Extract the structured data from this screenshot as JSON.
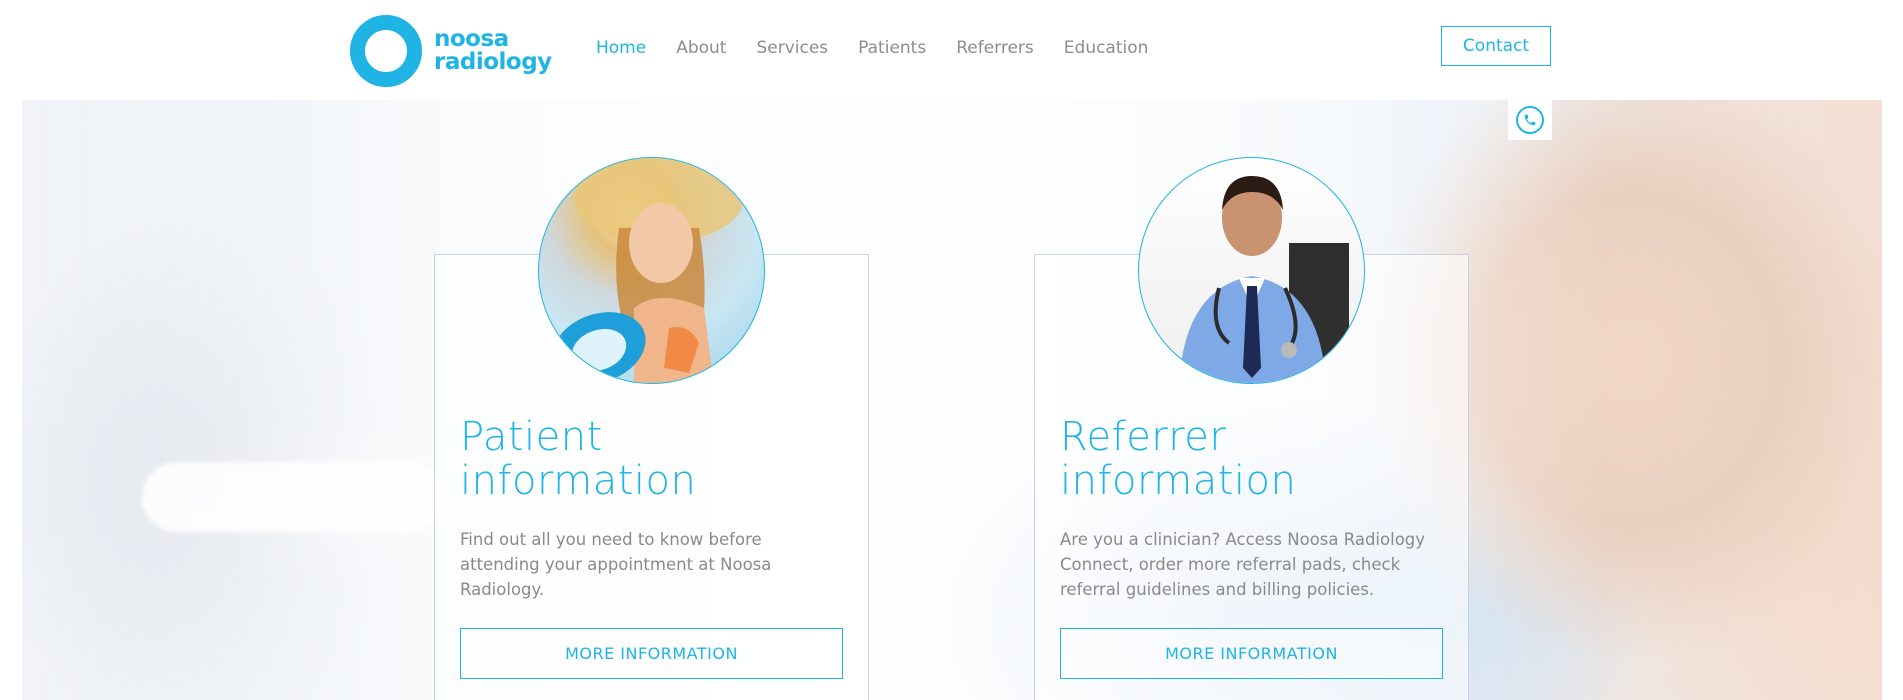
{
  "brand": {
    "name_line1": "noosa",
    "name_line2": "radiology",
    "color": "#1fb4e4"
  },
  "nav": {
    "items": [
      {
        "label": "Home",
        "active": true
      },
      {
        "label": "About",
        "active": false
      },
      {
        "label": "Services",
        "active": false
      },
      {
        "label": "Patients",
        "active": false
      },
      {
        "label": "Referrers",
        "active": false
      },
      {
        "label": "Education",
        "active": false
      }
    ]
  },
  "header": {
    "contact_label": "Contact",
    "phone_icon": "phone-icon"
  },
  "cards": [
    {
      "title_line1": "Patient",
      "title_line2": "information",
      "text": "Find out all you need to know before attending your appointment at Noosa Radiology.",
      "button_label": "MORE INFORMATION",
      "photo": "smiling woman in sun hat at the beach holding a blue frisbee"
    },
    {
      "title_line1": "Referrer",
      "title_line2": "information",
      "text": "Are you a clinician? Access Noosa Radiology Connect, order more referral pads, check referral guidelines and billing policies.",
      "button_label": "MORE INFORMATION",
      "photo": "smiling doctor in blue shirt and tie with stethoscope"
    }
  ],
  "colors": {
    "accent": "#1fb4e4",
    "text_muted": "#8a8a8a",
    "nav_text": "#8d8d8d"
  }
}
